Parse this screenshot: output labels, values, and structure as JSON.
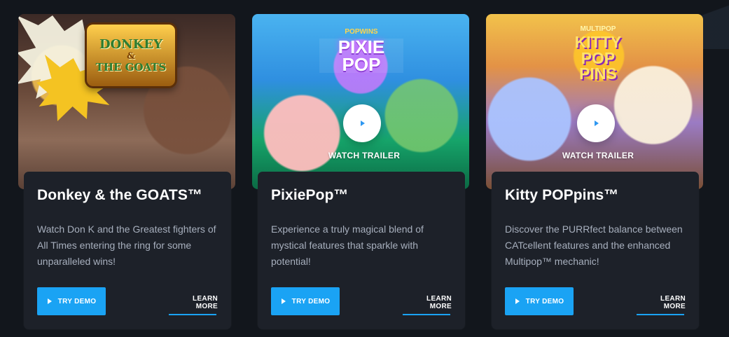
{
  "cards": [
    {
      "logo_line1": "DONKEY",
      "logo_line2": "&",
      "logo_line3": "THE GOATS",
      "title": "Donkey & the GOATS™",
      "description": "Watch Don K and the Greatest fighters of All Times entering the ring for some unparalleled wins!",
      "try_demo": "TRY DEMO",
      "learn_more": "LEARN MORE"
    },
    {
      "logo_small": "POPWINS",
      "logo_big_1": "PIXIE",
      "logo_big_2": "POP",
      "watch_trailer": "WATCH TRAILER",
      "title": "PixiePop™",
      "description": "Experience a truly magical blend of mystical features that sparkle with potential!",
      "try_demo": "TRY DEMO",
      "learn_more": "LEARN MORE"
    },
    {
      "logo_small": "MULTIPOP",
      "logo_big_1": "KITTY",
      "logo_big_2": "POP",
      "logo_big_3": "PINS",
      "watch_trailer": "WATCH TRAILER",
      "title": "Kitty POPpins™",
      "description": "Discover the PURRfect balance between CATcellent features and the enhanced Multipop™ mechanic!",
      "try_demo": "TRY DEMO",
      "learn_more": "LEARN MORE"
    }
  ],
  "colors": {
    "page_bg": "#12161c",
    "panel_bg": "#1d2129",
    "accent": "#1aa3f4",
    "text_primary": "#ffffff",
    "text_secondary": "#a7afbd"
  },
  "icons": {
    "play": "play-icon",
    "button_play": "play-icon"
  }
}
